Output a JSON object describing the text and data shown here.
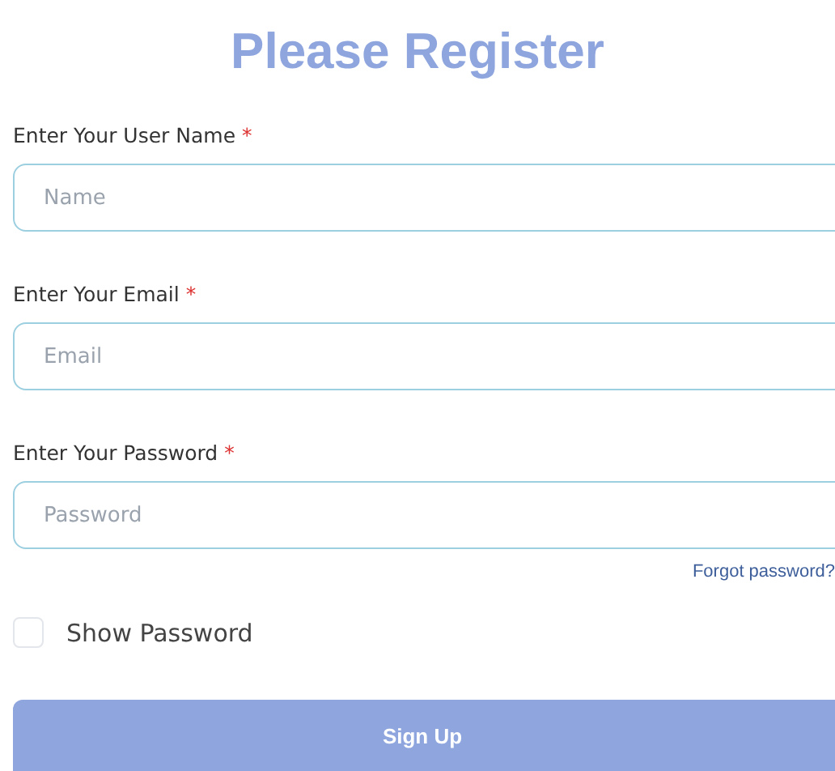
{
  "title": "Please Register",
  "fields": [
    {
      "label": "Enter Your User Name",
      "required_mark": "*",
      "placeholder": "Name"
    },
    {
      "label": "Enter Your Email",
      "required_mark": "*",
      "placeholder": "Email"
    },
    {
      "label": "Enter Your Password",
      "required_mark": "*",
      "placeholder": "Password"
    }
  ],
  "forgot_link": "Forgot password?",
  "show_password": {
    "label": "Show Password",
    "checked": false
  },
  "submit_button": "Sign Up"
}
